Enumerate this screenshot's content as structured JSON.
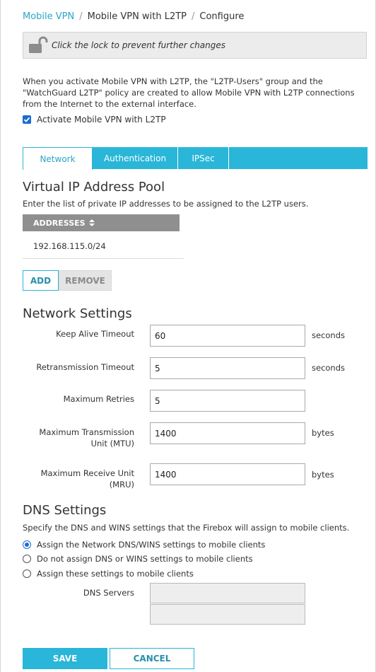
{
  "breadcrumb": {
    "items": [
      "Mobile VPN",
      "Mobile VPN with L2TP",
      "Configure"
    ],
    "separator": "/"
  },
  "lock_bar": {
    "text": "Click the lock to prevent further changes",
    "icon": "unlock-icon"
  },
  "intro": "When you activate Mobile VPN with L2TP, the \"L2TP-Users\" group and the \"WatchGuard L2TP\" policy are created to allow Mobile VPN with L2TP connections from the Internet to the external interface.",
  "activate": {
    "label": "Activate Mobile VPN with L2TP",
    "checked": true
  },
  "tabs": [
    {
      "label": "Network",
      "active": true
    },
    {
      "label": "Authentication",
      "active": false
    },
    {
      "label": "IPSec",
      "active": false
    }
  ],
  "pool": {
    "title": "Virtual IP Address Pool",
    "description": "Enter the list of private IP addresses to be assigned to the L2TP users.",
    "column": "ADDRESSES",
    "rows": [
      "192.168.115.0/24"
    ],
    "add_label": "ADD",
    "remove_label": "REMOVE"
  },
  "network_settings": {
    "title": "Network Settings",
    "fields": [
      {
        "label": "Keep Alive Timeout",
        "value": "60",
        "unit": "seconds"
      },
      {
        "label": "Retransmission Timeout",
        "value": "5",
        "unit": "seconds"
      },
      {
        "label": "Maximum Retries",
        "value": "5",
        "unit": ""
      },
      {
        "label_line1": "Maximum Transmission",
        "label_line2": "Unit (MTU)",
        "value": "1400",
        "unit": "bytes"
      },
      {
        "label_line1": "Maximum Receive Unit",
        "label_line2": "(MRU)",
        "value": "1400",
        "unit": "bytes"
      }
    ]
  },
  "dns_settings": {
    "title": "DNS Settings",
    "description": "Specify the DNS and WINS settings that the Firebox will assign to mobile clients.",
    "options": [
      {
        "label": "Assign the Network DNS/WINS settings to mobile clients",
        "selected": true
      },
      {
        "label": "Do not assign DNS or WINS settings to mobile clients",
        "selected": false
      },
      {
        "label": "Assign these settings to mobile clients",
        "selected": false
      }
    ],
    "dns_servers_label": "DNS Servers",
    "dns_server_values": [
      "",
      ""
    ]
  },
  "footer": {
    "save_label": "SAVE",
    "cancel_label": "CANCEL"
  },
  "colors": {
    "accent": "#29b6d8",
    "link": "#2aa6c6",
    "checkbox": "#1a6bd4"
  }
}
